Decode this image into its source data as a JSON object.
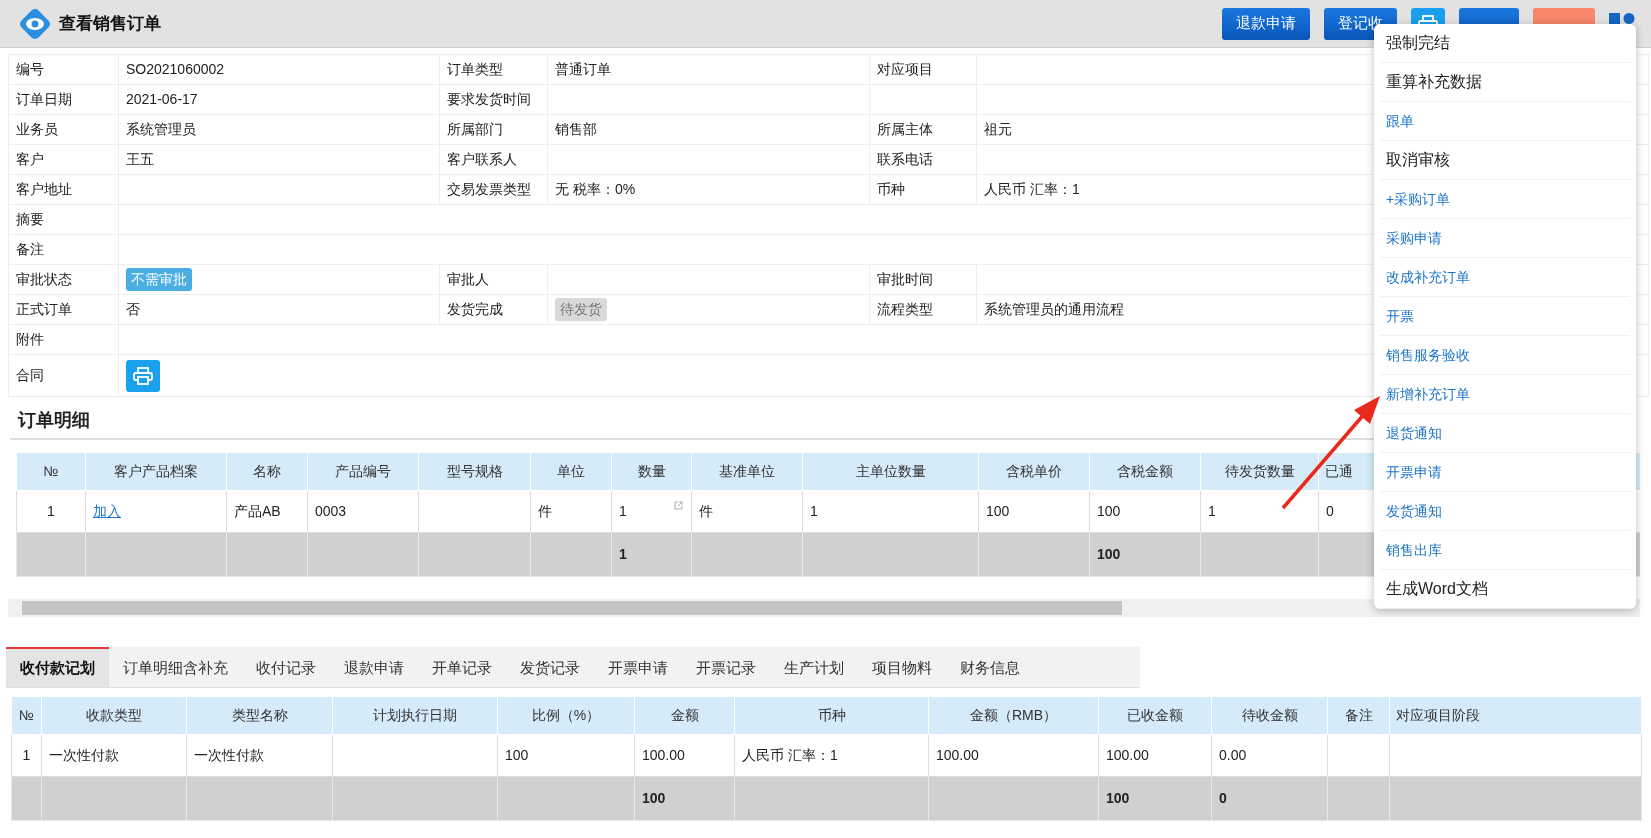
{
  "header": {
    "title": "查看销售订单",
    "buttons": [
      {
        "kind": "primary",
        "label": "退款申请"
      },
      {
        "kind": "primary",
        "label": "登记收"
      },
      {
        "kind": "print"
      },
      {
        "kind": "primary"
      },
      {
        "kind": "danger"
      },
      {
        "kind": "grid"
      }
    ]
  },
  "info": {
    "rows": [
      [
        {
          "label": "编号",
          "value": "SO2021060002"
        },
        {
          "label": "订单类型",
          "value": "普通订单"
        },
        {
          "label": "对应项目"
        }
      ],
      [
        {
          "label": "订单日期",
          "value": "2021-06-17"
        },
        {
          "label": "要求发货时间"
        }
      ],
      [
        {
          "label": "业务员",
          "value": "系统管理员"
        },
        {
          "label": "所属部门",
          "value": "销售部"
        },
        {
          "label": "所属主体",
          "value": "祖元"
        }
      ],
      [
        {
          "label": "客户",
          "value": "王五"
        },
        {
          "label": "客户联系人"
        },
        {
          "label": "联系电话"
        }
      ],
      [
        {
          "label": "客户地址"
        },
        {
          "label": "交易发票类型",
          "value": "无 税率：0%"
        },
        {
          "label": "币种",
          "value": "人民币 汇率：1"
        }
      ],
      [
        {
          "label": "摘要"
        }
      ],
      [
        {
          "label": "备注"
        }
      ],
      [
        {
          "label": "审批状态",
          "value": "不需审批",
          "kind": "badge",
          "color": "#4aaee3"
        },
        {
          "label": "审批人"
        },
        {
          "label": "审批时间"
        }
      ],
      [
        {
          "label": "正式订单",
          "value": "否"
        },
        {
          "label": "发货完成",
          "value": "待发货",
          "kind": "badge",
          "color": "#d9d9d9"
        },
        {
          "label": "流程类型",
          "value": "系统管理员的通用流程"
        }
      ],
      [
        {
          "label": "附件"
        }
      ],
      [
        {
          "label": "合同",
          "kind": "print"
        }
      ]
    ]
  },
  "details": {
    "title": "订单明细",
    "columns": [
      {
        "header": "№",
        "value": "1"
      },
      {
        "header": "客户产品档案",
        "value": "加入",
        "kind": "link"
      },
      {
        "header": "名称",
        "value": "产品AB"
      },
      {
        "header": "产品编号",
        "value": "0003"
      },
      {
        "header": "型号规格"
      },
      {
        "header": "单位",
        "value": "件"
      },
      {
        "header": "数量",
        "value": "1",
        "kind": "editable",
        "total": "1"
      },
      {
        "header": "基准单位",
        "value": "件"
      },
      {
        "header": "主单位数量",
        "value": "1"
      },
      {
        "header": "含税单价",
        "value": "100"
      },
      {
        "header": "含税金额",
        "value": "100",
        "total": "100"
      },
      {
        "header": "待发货数量",
        "value": "1"
      },
      {
        "header": "已通",
        "value": "0"
      }
    ]
  },
  "tabs": [
    {
      "label": "收付款记划",
      "selected": true
    },
    {
      "label": "订单明细含补充",
      "selected": false
    },
    {
      "label": "收付记录",
      "selected": false
    },
    {
      "label": "退款申请",
      "selected": false
    },
    {
      "label": "开单记录",
      "selected": false
    },
    {
      "label": "发货记录",
      "selected": false
    },
    {
      "label": "开票申请",
      "selected": false
    },
    {
      "label": "开票记录",
      "selected": false
    },
    {
      "label": "生产计划",
      "selected": false
    },
    {
      "label": "项目物料",
      "selected": false
    },
    {
      "label": "财务信息",
      "selected": false
    }
  ],
  "payments": {
    "columns": [
      {
        "header": "№",
        "value": "1"
      },
      {
        "header": "收款类型",
        "value": "一次性付款"
      },
      {
        "header": "类型名称",
        "value": "一次性付款"
      },
      {
        "header": "计划执行日期"
      },
      {
        "header": "比例（%）",
        "value": "100"
      },
      {
        "header": "金额",
        "value": "100.00",
        "total": "100"
      },
      {
        "header": "币种",
        "value": "人民币 汇率：1"
      },
      {
        "header": "金额（RMB）",
        "value": "100.00"
      },
      {
        "header": "已收金额",
        "value": "100.00",
        "total": "100"
      },
      {
        "header": "待收金额",
        "value": "0.00",
        "total": "0"
      },
      {
        "header": "备注"
      },
      {
        "header": "对应项目阶段"
      }
    ]
  },
  "menu": {
    "items": [
      {
        "kind": "action",
        "label": "强制完结"
      },
      {
        "kind": "action",
        "label": "重算补充数据"
      },
      {
        "kind": "link",
        "label": "跟单"
      },
      {
        "kind": "action",
        "label": "取消审核"
      },
      {
        "kind": "link",
        "label": "+采购订单"
      },
      {
        "kind": "link",
        "label": "采购申请"
      },
      {
        "kind": "link",
        "label": "改成补充订单"
      },
      {
        "kind": "link",
        "label": "开票"
      },
      {
        "kind": "link",
        "label": "销售服务验收"
      },
      {
        "kind": "link",
        "label": "新增补充订单"
      },
      {
        "kind": "link",
        "label": "退货通知"
      },
      {
        "kind": "link",
        "label": "开票申请"
      },
      {
        "kind": "link",
        "label": "发货通知"
      },
      {
        "kind": "link",
        "label": "销售出库"
      },
      {
        "kind": "action",
        "label": "生成Word文档"
      }
    ]
  }
}
